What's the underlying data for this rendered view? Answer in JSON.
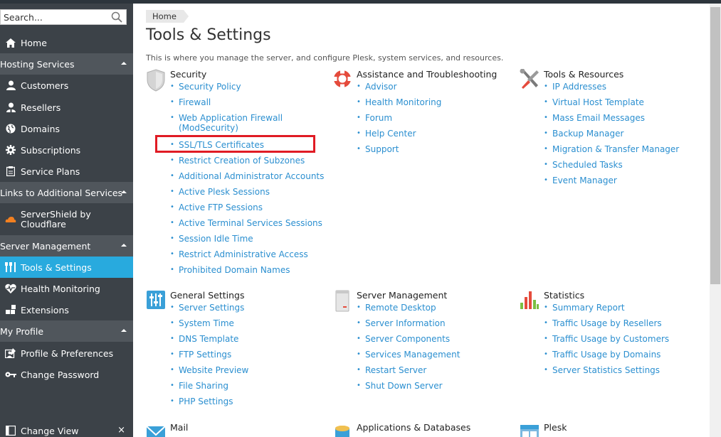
{
  "search": {
    "placeholder": "Search..."
  },
  "sidebar": {
    "home": "Home",
    "groups": {
      "hosting": "Hosting Services",
      "links": "Links to Additional Services",
      "server": "Server Management",
      "profile": "My Profile",
      "change_view": "Change View"
    },
    "hosting_items": [
      "Customers",
      "Resellers",
      "Domains",
      "Subscriptions",
      "Service Plans"
    ],
    "links_items": [
      "ServerShield by",
      "Cloudflare"
    ],
    "server_items": [
      "Tools & Settings",
      "Health Monitoring",
      "Extensions"
    ],
    "profile_items": [
      "Profile & Preferences",
      "Change Password"
    ]
  },
  "breadcrumb": "Home",
  "page": {
    "title": "Tools & Settings",
    "intro": "This is where you manage the server, and configure Plesk, system services, and resources."
  },
  "sections": {
    "security": {
      "title": "Security",
      "items": [
        "Security Policy",
        "Firewall",
        "Web Application Firewall",
        "(ModSecurity)",
        "SSL/TLS Certificates",
        "Restrict Creation of Subzones",
        "Additional Administrator Accounts",
        "Active Plesk Sessions",
        "Active FTP Sessions",
        "Active Terminal Services Sessions",
        "Session Idle Time",
        "Restrict Administrative Access",
        "Prohibited Domain Names"
      ]
    },
    "assistance": {
      "title": "Assistance and Troubleshooting",
      "items": [
        "Advisor",
        "Health Monitoring",
        "Forum",
        "Help Center",
        "Support"
      ]
    },
    "tools": {
      "title": "Tools & Resources",
      "items": [
        "IP Addresses",
        "Virtual Host Template",
        "Mass Email Messages",
        "Backup Manager",
        "Migration & Transfer Manager",
        "Scheduled Tasks",
        "Event Manager"
      ]
    },
    "general": {
      "title": "General Settings",
      "items": [
        "Server Settings",
        "System Time",
        "DNS Template",
        "FTP Settings",
        "Website Preview",
        "File Sharing",
        "PHP Settings"
      ]
    },
    "server_mgmt": {
      "title": "Server Management",
      "items": [
        "Remote Desktop",
        "Server Information",
        "Server Components",
        "Services Management",
        "Restart Server",
        "Shut Down Server"
      ]
    },
    "statistics": {
      "title": "Statistics",
      "items": [
        "Summary Report",
        "Traffic Usage by Resellers",
        "Traffic Usage by Customers",
        "Traffic Usage by Domains",
        "Server Statistics Settings"
      ]
    },
    "mail": {
      "title": "Mail"
    },
    "apps": {
      "title": "Applications & Databases"
    },
    "plesk": {
      "title": "Plesk"
    }
  },
  "colors": {
    "sidebar_bg": "#3c4248",
    "active": "#28aade",
    "link": "#2b8fd0",
    "highlight": "#e01b24"
  }
}
